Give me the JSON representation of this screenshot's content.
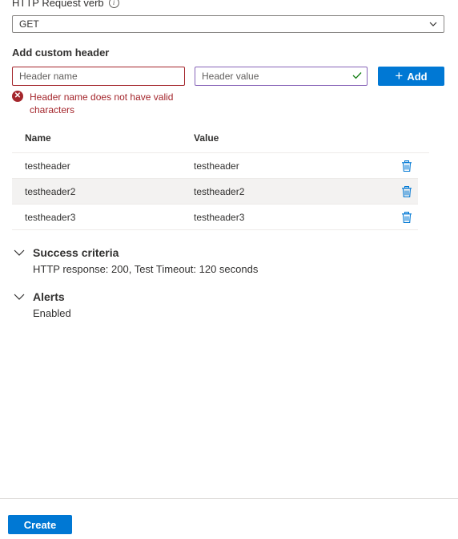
{
  "verb": {
    "label": "HTTP Request verb",
    "selected": "GET"
  },
  "custom_header": {
    "title": "Add custom header",
    "name_placeholder": "Header name",
    "value_placeholder": "Header value",
    "add_label": "Add",
    "error": "Header name does not have valid characters"
  },
  "table": {
    "columns": [
      "Name",
      "Value"
    ],
    "rows": [
      {
        "name": "testheader",
        "value": "testheader"
      },
      {
        "name": "testheader2",
        "value": "testheader2"
      },
      {
        "name": "testheader3",
        "value": "testheader3"
      }
    ]
  },
  "success": {
    "title": "Success criteria",
    "detail": "HTTP response: 200, Test Timeout: 120 seconds"
  },
  "alerts": {
    "title": "Alerts",
    "detail": "Enabled"
  },
  "footer": {
    "create_label": "Create"
  },
  "colors": {
    "primary": "#0078d4",
    "error": "#a4262c",
    "success_check": "#107c10",
    "row_alt": "#f3f2f1"
  },
  "icons": [
    "info-icon",
    "chevron-down-icon",
    "check-icon",
    "plus-icon",
    "error-icon",
    "trash-icon"
  ]
}
